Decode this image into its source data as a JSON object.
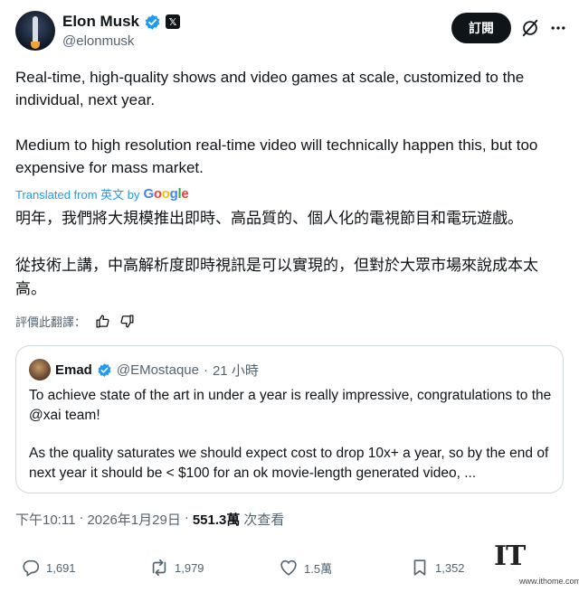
{
  "author": {
    "name": "Elon Musk",
    "handle": "@elonmusk",
    "x_badge": "𝕏"
  },
  "header": {
    "subscribe_label": "訂閱",
    "icons": [
      "verified-badge-icon",
      "grok-icon",
      "more-icon"
    ]
  },
  "tweet": {
    "paragraphs": [
      "Real-time, high-quality shows and video games at scale, customized to the individual, next year.",
      "Medium to high resolution real-time video will technically happen this, but too expensive for mass market."
    ],
    "translated_from": "Translated from 英文 by",
    "google": [
      "G",
      "o",
      "o",
      "g",
      "l",
      "e"
    ],
    "translation": [
      "明年，我們將大規模推出即時、高品質的、個人化的電視節目和電玩遊戲。",
      "從技術上講，中高解析度即時視訊是可以實現的，但對於大眾市場來說成本太高。"
    ],
    "rate_label": "評價此翻譯："
  },
  "quote": {
    "name": "Emad",
    "handle": "@EMostaque",
    "dot": "·",
    "time": "21 小時",
    "paragraphs": [
      "To achieve state of the art in under a year is really impressive, congratulations to the @xai team!",
      "As the quality saturates we should expect cost to drop 10x+ a year, so by the end of next year it should be < $100 for an ok movie-length generated video, ..."
    ]
  },
  "meta": {
    "time": "下午10:11",
    "dot1": "·",
    "date": "2026年1月29日",
    "dot2": "·",
    "views_count": "551.3萬",
    "views_label": "次查看"
  },
  "actions": {
    "replies": "1,691",
    "reposts": "1,979",
    "likes": "1.5萬",
    "bookmarks": "1,352"
  },
  "watermark": {
    "logo": "IT",
    "url": "www.ithome.com"
  },
  "colors": {
    "text": "#0f1419",
    "secondary": "#536471",
    "link": "#1d9bf0",
    "border": "#cfd9de",
    "verified": "#1d9bf0"
  }
}
